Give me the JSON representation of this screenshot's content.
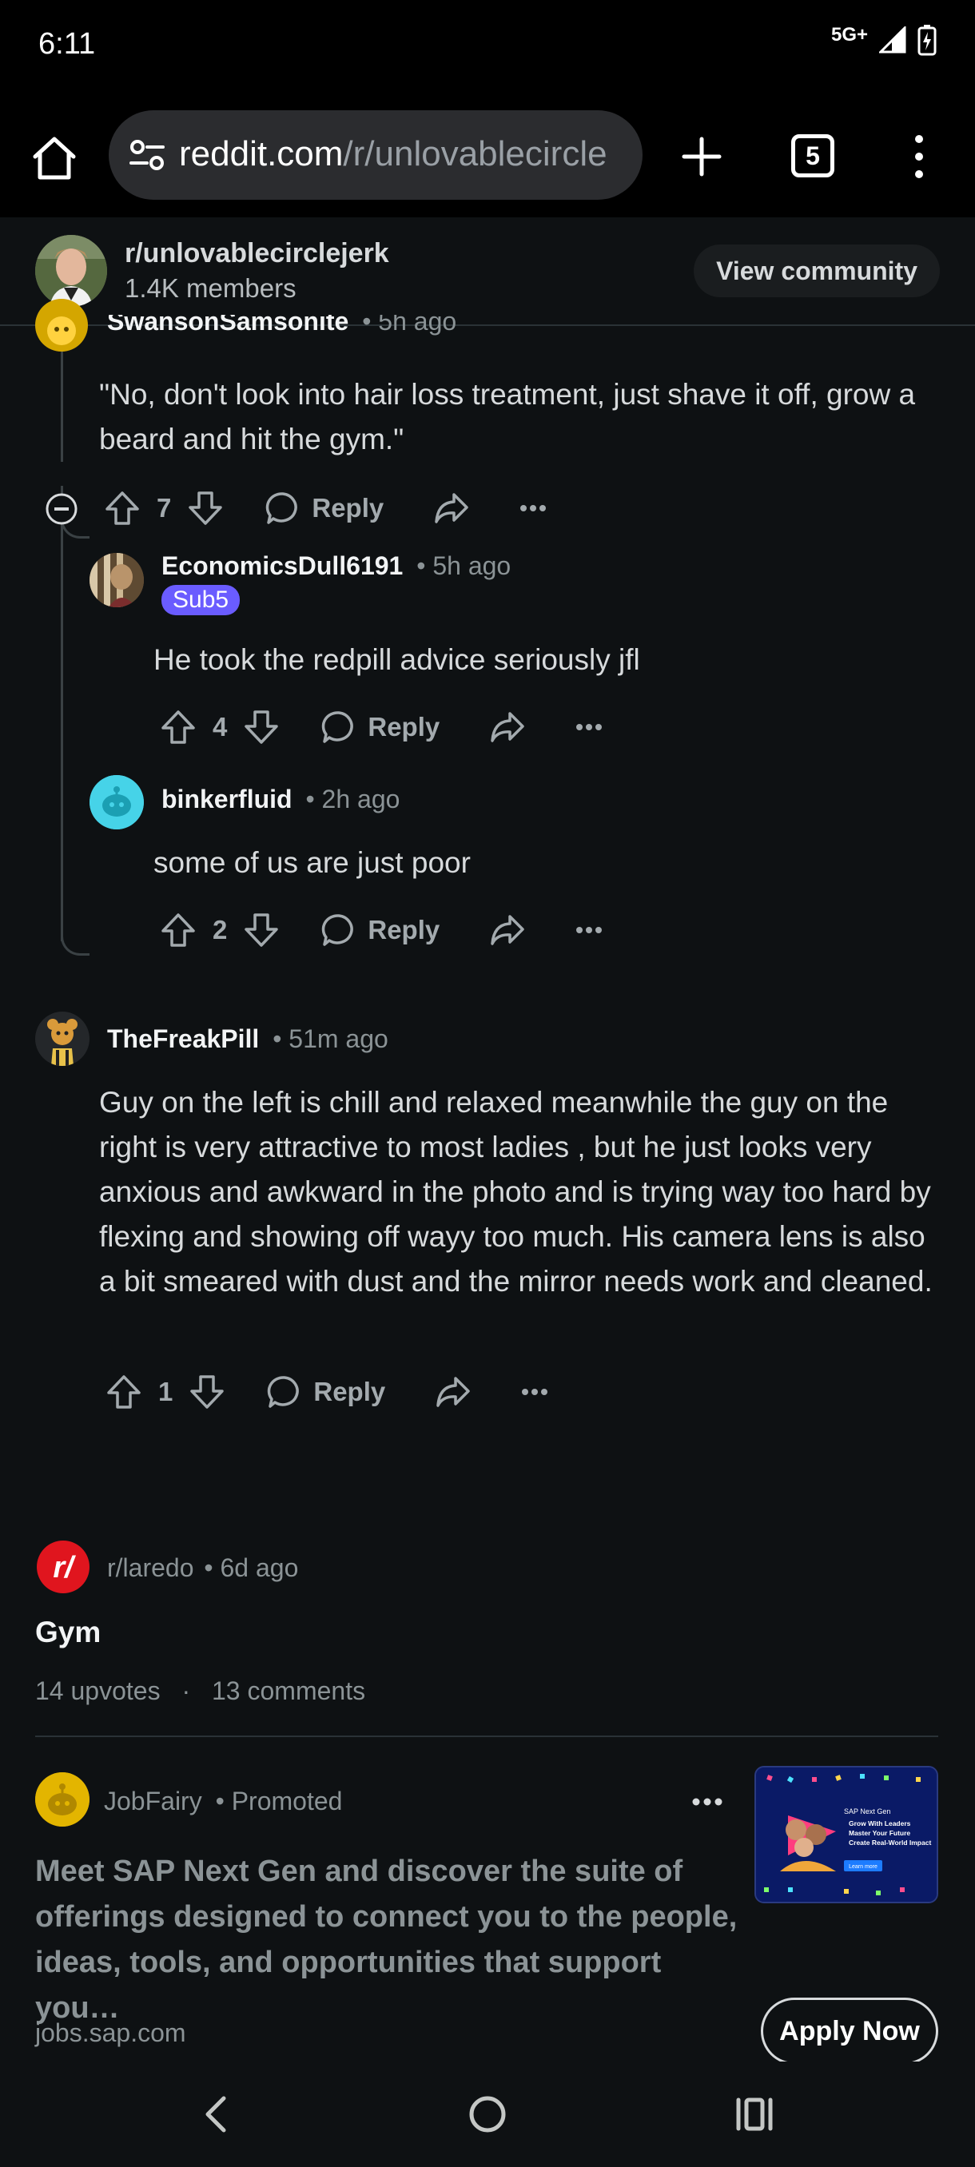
{
  "status_bar": {
    "time": "6:11",
    "network": "5G+"
  },
  "browser": {
    "url_domain": "reddit.com",
    "url_path": "/r/unlovablecircle",
    "tab_count": "5"
  },
  "community": {
    "name": "r/unlovablecirclejerk",
    "members": "1.4K members",
    "view_button": "View community"
  },
  "comments": [
    {
      "author": "SwansonSamsonite",
      "time": "• 5h ago",
      "body": "\"No, don't look into hair loss treatment, just shave it off, grow a beard and hit the gym.\"",
      "votes": "7",
      "reply_label": "Reply"
    },
    {
      "author": "EconomicsDull6191",
      "time": "• 5h ago",
      "flair": "Sub5",
      "body": "He took the redpill advice seriously jfl",
      "votes": "4",
      "reply_label": "Reply"
    },
    {
      "author": "binkerfluid",
      "time": "• 2h ago",
      "body": "some of us are just poor",
      "votes": "2",
      "reply_label": "Reply"
    },
    {
      "author": "TheFreakPill",
      "time": "• 51m ago",
      "body": "Guy on the left is chill and relaxed meanwhile the guy on the right is very attractive to most ladies , but he just looks very anxious and awkward in the photo and is trying way too hard by flexing and showing off wayy too much. His camera lens is also a bit smeared with dust and the mirror needs work and cleaned.",
      "votes": "1",
      "reply_label": "Reply"
    }
  ],
  "related_post": {
    "subreddit": "r/laredo",
    "time": "• 6d ago",
    "title": "Gym",
    "upvotes": "14 upvotes",
    "separator": "·",
    "comments": "13 comments"
  },
  "ad": {
    "advertiser": "JobFairy",
    "promoted": "• Promoted",
    "text": "Meet SAP Next Gen and discover the suite of offerings designed to connect you to the people, ideas, tools, and opportunities that support you…",
    "domain": "jobs.sap.com",
    "cta": "Apply Now",
    "thumb_title": "SAP Next Gen",
    "thumb_points": [
      "Grow With Leaders",
      "Master Your Future",
      "Create Real-World Impact"
    ],
    "thumb_button": "Learn more"
  },
  "colors": {
    "background": "#0e1113",
    "text": "#d7dadc",
    "meta": "#8b9396",
    "flair": "#6a5cff",
    "subreddit_icon": "#e0151e"
  }
}
